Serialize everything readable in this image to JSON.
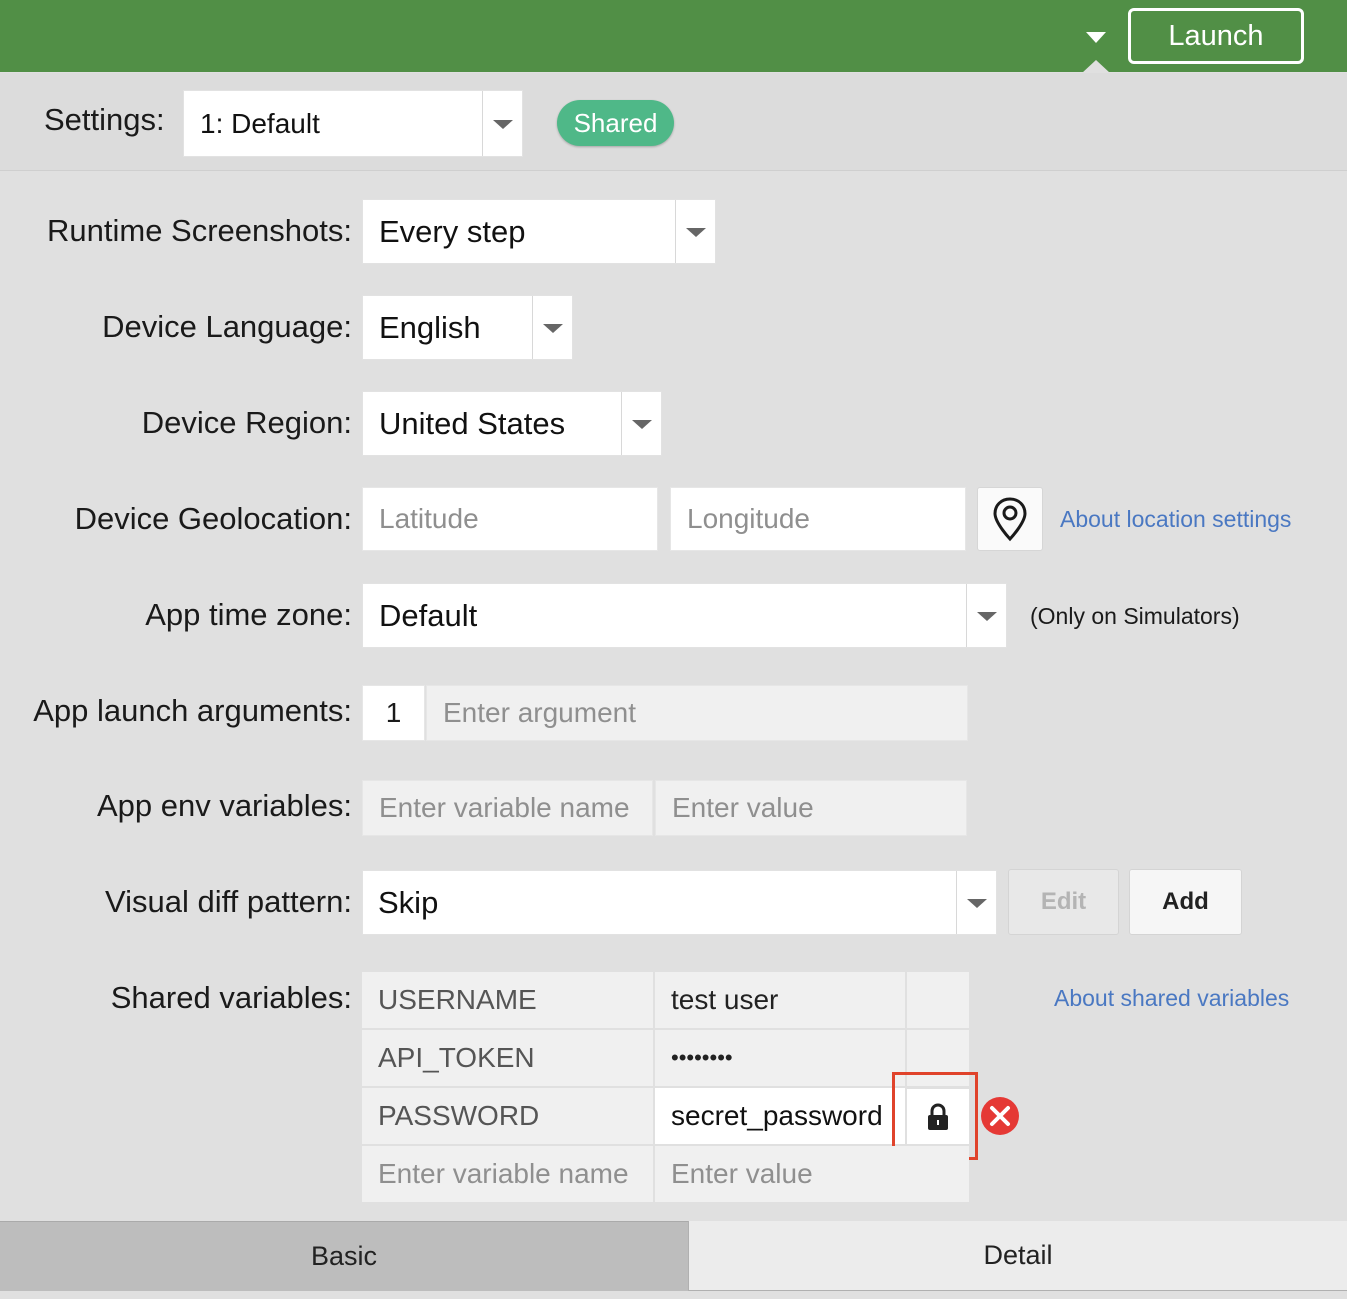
{
  "header": {
    "launch_label": "Launch",
    "colors": {
      "bar": "#518f46"
    }
  },
  "settings": {
    "label": "Settings:",
    "selected": "1: Default",
    "badge": "Shared"
  },
  "form": {
    "runtime_screenshots": {
      "label": "Runtime Screenshots:",
      "value": "Every step"
    },
    "device_language": {
      "label": "Device Language:",
      "value": "English"
    },
    "device_region": {
      "label": "Device Region:",
      "value": "United States"
    },
    "geolocation": {
      "label": "Device Geolocation:",
      "latitude_placeholder": "Latitude",
      "longitude_placeholder": "Longitude",
      "link": "About location settings",
      "icon": "map-pin-icon"
    },
    "time_zone": {
      "label": "App time zone:",
      "value": "Default",
      "note": "(Only on Simulators)"
    },
    "launch_args": {
      "label": "App launch arguments:",
      "index": "1",
      "placeholder": "Enter argument"
    },
    "env_vars": {
      "label": "App env variables:",
      "name_placeholder": "Enter variable name",
      "value_placeholder": "Enter value"
    },
    "visual_diff": {
      "label": "Visual diff pattern:",
      "value": "Skip",
      "edit_label": "Edit",
      "add_label": "Add"
    },
    "shared_vars": {
      "label": "Shared variables:",
      "link": "About shared variables",
      "rows": [
        {
          "name": "USERNAME",
          "value": "test user"
        },
        {
          "name": "API_TOKEN",
          "value": "••••••••"
        },
        {
          "name": "PASSWORD",
          "value": "secret_password"
        }
      ],
      "name_placeholder": "Enter variable name",
      "value_placeholder": "Enter value",
      "lock_icon": "lock-icon",
      "remove_icon": "remove-icon",
      "colors": {
        "highlight": "#e0432b",
        "remove": "#e53935"
      }
    }
  },
  "tabs": {
    "basic": "Basic",
    "detail": "Detail"
  }
}
